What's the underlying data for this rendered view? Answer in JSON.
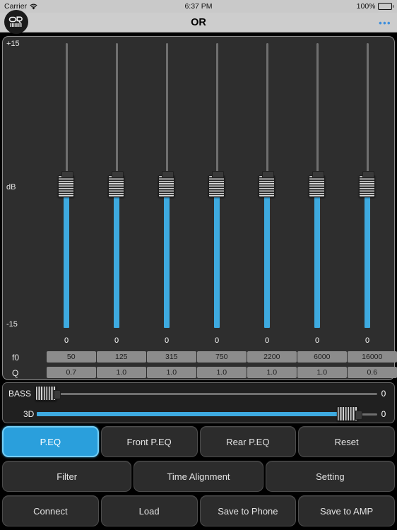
{
  "status_bar": {
    "carrier": "Carrier",
    "wifi_icon": "wifi-icon",
    "time": "6:37 PM",
    "battery_percent": "100%",
    "battery_icon": "battery-full-icon"
  },
  "nav_bar": {
    "logo_icon": "app-logo-icon",
    "logo_text": "OR",
    "title": "OR",
    "more_label": "•••"
  },
  "eq_panel": {
    "axis_top_label": "+15",
    "axis_mid_label": "dB",
    "axis_bottom_label": "-15",
    "gain_row_label": "",
    "f0_label": "f0",
    "q_label": "Q",
    "bands": [
      {
        "gain": "0",
        "f0": "50",
        "q": "0.7"
      },
      {
        "gain": "0",
        "f0": "125",
        "q": "1.0"
      },
      {
        "gain": "0",
        "f0": "315",
        "q": "1.0"
      },
      {
        "gain": "0",
        "f0": "750",
        "q": "1.0"
      },
      {
        "gain": "0",
        "f0": "2200",
        "q": "1.0"
      },
      {
        "gain": "0",
        "f0": "6000",
        "q": "1.0"
      },
      {
        "gain": "0",
        "f0": "16000",
        "q": "0.6"
      }
    ]
  },
  "h_sliders": {
    "bass": {
      "label": "BASS",
      "value": "0"
    },
    "three_d": {
      "label": "3D",
      "value": "0"
    }
  },
  "buttons": {
    "row1": [
      {
        "label": "P.EQ",
        "active": true
      },
      {
        "label": "Front P.EQ",
        "active": false
      },
      {
        "label": "Rear P.EQ",
        "active": false
      },
      {
        "label": "Reset",
        "active": false
      }
    ],
    "row2": [
      {
        "label": "Filter",
        "active": false
      },
      {
        "label": "Time Alignment",
        "active": false
      },
      {
        "label": "Setting",
        "active": false
      }
    ],
    "row3": [
      {
        "label": "Connect",
        "active": false
      },
      {
        "label": "Load",
        "active": false
      },
      {
        "label": "Save to Phone",
        "active": false
      },
      {
        "label": "Save to AMP",
        "active": false
      }
    ]
  },
  "colors": {
    "accent_blue": "#3eaae0",
    "active_button": "#2a9fdc",
    "panel_bg": "#2e2e2e",
    "cell_bg": "#8c8c8c"
  }
}
